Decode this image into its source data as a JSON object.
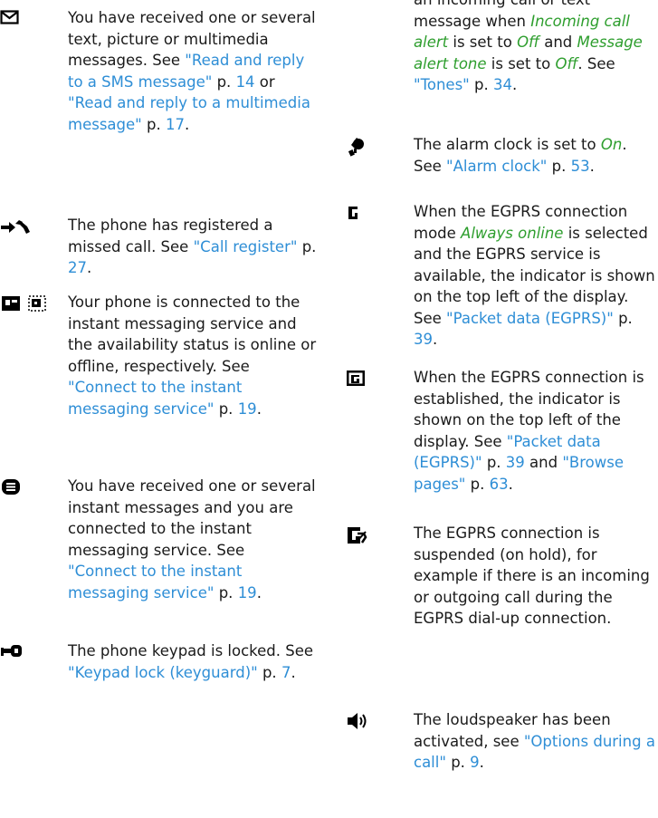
{
  "left_column": [
    {
      "icon": "envelope-icon",
      "segments": [
        {
          "t": "You have received one or several text, picture or multimedia messages. See "
        },
        {
          "t": "\"Read and reply to a SMS message\"",
          "k": "link"
        },
        {
          "t": " p. "
        },
        {
          "t": "14",
          "k": "link"
        },
        {
          "t": " or "
        },
        {
          "t": "\"Read and reply to a multimedia message\"",
          "k": "link"
        },
        {
          "t": " p. "
        },
        {
          "t": "17",
          "k": "link"
        },
        {
          "t": "."
        }
      ]
    },
    {
      "icon": "missed-call-icon",
      "segments": [
        {
          "t": "The phone has registered a missed call. See "
        },
        {
          "t": "\"Call register\"",
          "k": "link"
        },
        {
          "t": " p. "
        },
        {
          "t": "27",
          "k": "link"
        },
        {
          "t": "."
        }
      ]
    },
    {
      "icon": "im-status-icons",
      "segments": [
        {
          "t": "Your phone is connected to the instant messaging service and the availability status is online or offline, respectively. See "
        },
        {
          "t": "\"Connect to the instant messaging service\"",
          "k": "link"
        },
        {
          "t": " p. "
        },
        {
          "t": "19",
          "k": "link"
        },
        {
          "t": "."
        }
      ]
    },
    {
      "icon": "instant-message-icon",
      "segments": [
        {
          "t": "You have received one or several instant messages and you are connected to the instant messaging service. See "
        },
        {
          "t": "\"Connect to the instant messaging service\"",
          "k": "link"
        },
        {
          "t": " p. "
        },
        {
          "t": "19",
          "k": "link"
        },
        {
          "t": "."
        }
      ]
    },
    {
      "icon": "keypad-lock-icon",
      "segments": [
        {
          "t": "The phone keypad is locked. See "
        },
        {
          "t": "\"Keypad lock (keyguard)\"",
          "k": "link"
        },
        {
          "t": " p. "
        },
        {
          "t": "7",
          "k": "link"
        },
        {
          "t": "."
        }
      ]
    }
  ],
  "right_column": [
    {
      "icon": "",
      "segments": [
        {
          "t": "an incoming call or text message when "
        },
        {
          "t": "Incoming call alert",
          "k": "em"
        },
        {
          "t": " is set to "
        },
        {
          "t": "Off",
          "k": "em"
        },
        {
          "t": " and "
        },
        {
          "t": "Message alert tone",
          "k": "em"
        },
        {
          "t": " is set to "
        },
        {
          "t": "Off",
          "k": "em"
        },
        {
          "t": ". See "
        },
        {
          "t": "\"Tones\"",
          "k": "link"
        },
        {
          "t": " p. "
        },
        {
          "t": "34",
          "k": "link"
        },
        {
          "t": "."
        }
      ]
    },
    {
      "icon": "alarm-clock-icon",
      "segments": [
        {
          "t": "The alarm clock is set to "
        },
        {
          "t": "On",
          "k": "em"
        },
        {
          "t": ". See "
        },
        {
          "t": "\"Alarm clock\"",
          "k": "link"
        },
        {
          "t": " p. "
        },
        {
          "t": "53",
          "k": "link"
        },
        {
          "t": "."
        }
      ]
    },
    {
      "icon": "egprs-g-icon",
      "segments": [
        {
          "t": "When the EGPRS connection mode "
        },
        {
          "t": "Always online",
          "k": "em"
        },
        {
          "t": " is selected and the EGPRS service is available, the indicator is shown on the top left of the display. See "
        },
        {
          "t": "\"Packet data (EGPRS)\"",
          "k": "link"
        },
        {
          "t": " p. "
        },
        {
          "t": "39",
          "k": "link"
        },
        {
          "t": "."
        }
      ]
    },
    {
      "icon": "egprs-connected-icon",
      "segments": [
        {
          "t": "When the EGPRS connection is established, the indicator is shown on the top left of the display. See "
        },
        {
          "t": "\"Packet data (EGPRS)\"",
          "k": "link"
        },
        {
          "t": " p. "
        },
        {
          "t": "39",
          "k": "link"
        },
        {
          "t": " and "
        },
        {
          "t": "\"Browse pages\"",
          "k": "link"
        },
        {
          "t": " p. "
        },
        {
          "t": "63",
          "k": "link"
        },
        {
          "t": "."
        }
      ]
    },
    {
      "icon": "egprs-suspended-icon",
      "segments": [
        {
          "t": "The EGPRS connection is suspended (on hold), for example if there is an incoming or outgoing call during the EGPRS dial-up connection."
        }
      ]
    },
    {
      "icon": "loudspeaker-icon",
      "segments": [
        {
          "t": "The loudspeaker has been activated, see "
        },
        {
          "t": "\"Options during a call\"",
          "k": "link"
        },
        {
          "t": " p. "
        },
        {
          "t": "9",
          "k": "link"
        },
        {
          "t": "."
        }
      ]
    }
  ]
}
